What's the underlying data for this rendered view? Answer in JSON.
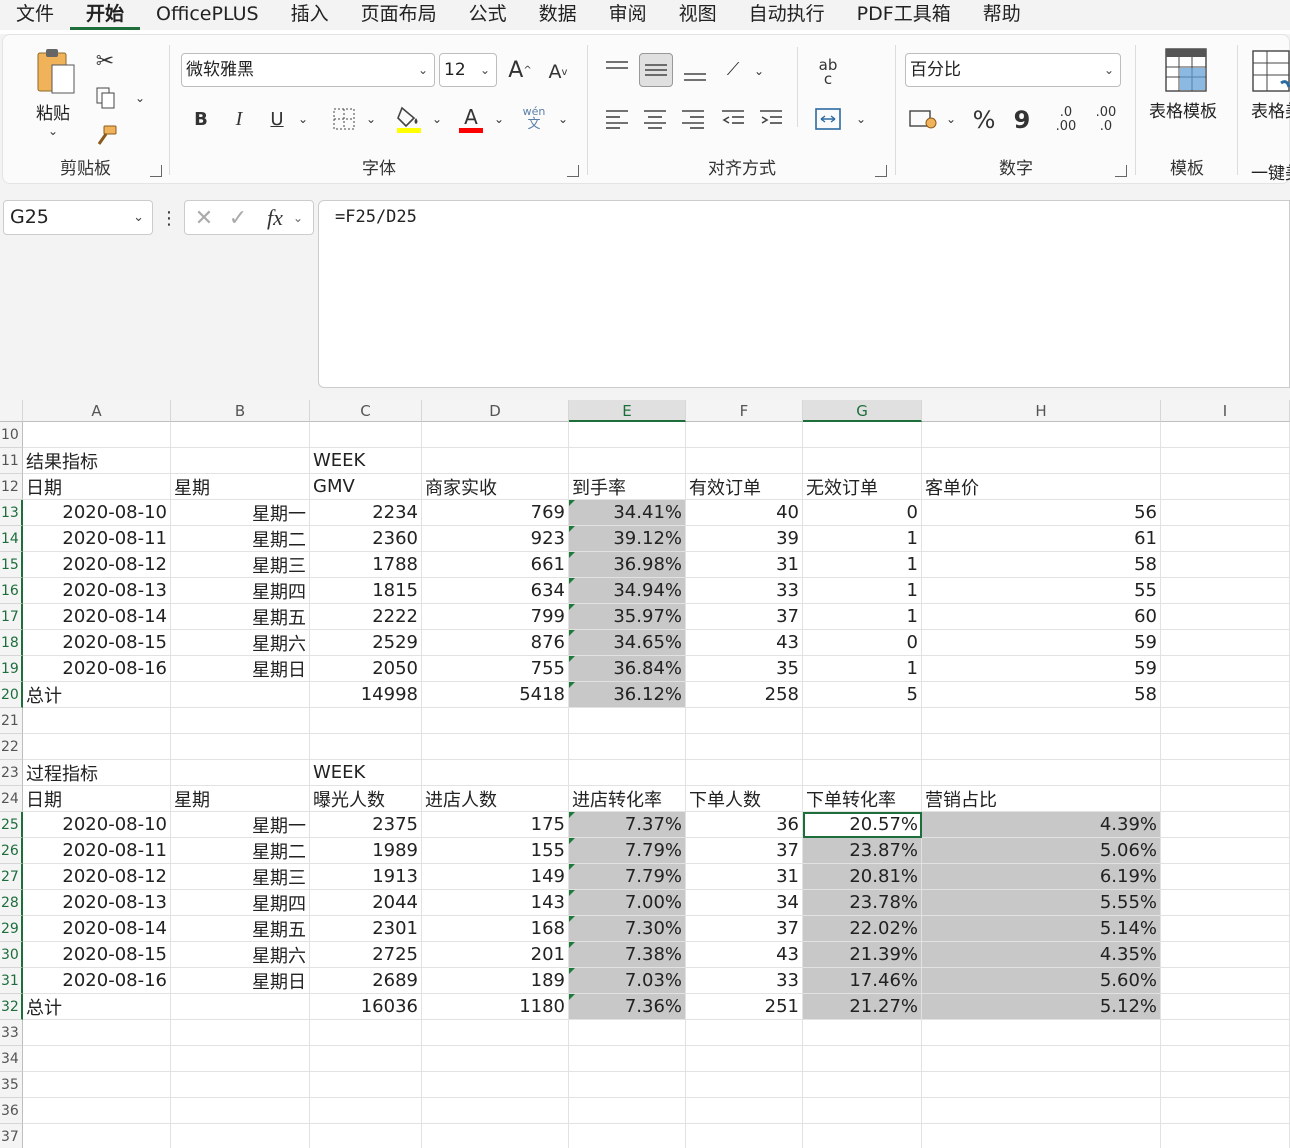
{
  "menu": [
    "文件",
    "开始",
    "OfficePLUS",
    "插入",
    "页面布局",
    "公式",
    "数据",
    "审阅",
    "视图",
    "自动执行",
    "PDF工具箱",
    "帮助"
  ],
  "ribbon": {
    "clipboard": {
      "label": "剪贴板",
      "paste": "粘贴"
    },
    "font": {
      "label": "字体",
      "font_name": "微软雅黑",
      "font_size": "12",
      "bold": "B",
      "italic": "I",
      "underline": "U",
      "grow": "A",
      "shrink": "A",
      "font_color": "A",
      "phonetic_top": "wén",
      "phonetic_bottom": "文"
    },
    "alignment": {
      "label": "对齐方式",
      "abc_top": "ab",
      "abc_bottom": "c"
    },
    "number": {
      "label": "数字",
      "format": "百分比",
      "percent": "%",
      "comma": "9",
      "inc_top": ".0",
      "inc_bottom": ".00",
      "dec_top": ".00",
      "dec_bottom": ".0"
    },
    "templates": {
      "label": "模板",
      "btn": "表格模板"
    },
    "oneclick": {
      "label": "一键美",
      "btn": "表格美"
    }
  },
  "formula_bar": {
    "name_box": "G25",
    "fx": "fx",
    "formula": "=F25/D25"
  },
  "columns": [
    "A",
    "B",
    "C",
    "D",
    "E",
    "F",
    "G",
    "H",
    "I"
  ],
  "row_numbers": [
    "10",
    "11",
    "12",
    "13",
    "14",
    "15",
    "16",
    "17",
    "18",
    "19",
    "20",
    "21",
    "22",
    "23",
    "24",
    "25",
    "26",
    "27",
    "28",
    "29",
    "30",
    "31",
    "32",
    "33",
    "34",
    "35",
    "36",
    "37"
  ],
  "table1": {
    "title": "结果指标",
    "week": "WEEK",
    "headers": [
      "日期",
      "星期",
      "GMV",
      "商家实收",
      "到手率",
      "有效订单",
      "无效订单",
      "客单价"
    ],
    "rows": [
      [
        "2020-08-10",
        "星期一",
        "2234",
        "769",
        "34.41%",
        "40",
        "0",
        "56"
      ],
      [
        "2020-08-11",
        "星期二",
        "2360",
        "923",
        "39.12%",
        "39",
        "1",
        "61"
      ],
      [
        "2020-08-12",
        "星期三",
        "1788",
        "661",
        "36.98%",
        "31",
        "1",
        "58"
      ],
      [
        "2020-08-13",
        "星期四",
        "1815",
        "634",
        "34.94%",
        "33",
        "1",
        "55"
      ],
      [
        "2020-08-14",
        "星期五",
        "2222",
        "799",
        "35.97%",
        "37",
        "1",
        "60"
      ],
      [
        "2020-08-15",
        "星期六",
        "2529",
        "876",
        "34.65%",
        "43",
        "0",
        "59"
      ],
      [
        "2020-08-16",
        "星期日",
        "2050",
        "755",
        "36.84%",
        "35",
        "1",
        "59"
      ]
    ],
    "total": [
      "总计",
      "",
      "14998",
      "5418",
      "36.12%",
      "258",
      "5",
      "58"
    ]
  },
  "table2": {
    "title": "过程指标",
    "week": "WEEK",
    "headers": [
      "日期",
      "星期",
      "曝光人数",
      "进店人数",
      "进店转化率",
      "下单人数",
      "下单转化率",
      "营销占比"
    ],
    "rows": [
      [
        "2020-08-10",
        "星期一",
        "2375",
        "175",
        "7.37%",
        "36",
        "20.57%",
        "4.39%"
      ],
      [
        "2020-08-11",
        "星期二",
        "1989",
        "155",
        "7.79%",
        "37",
        "23.87%",
        "5.06%"
      ],
      [
        "2020-08-12",
        "星期三",
        "1913",
        "149",
        "7.79%",
        "31",
        "20.81%",
        "6.19%"
      ],
      [
        "2020-08-13",
        "星期四",
        "2044",
        "143",
        "7.00%",
        "34",
        "23.78%",
        "5.55%"
      ],
      [
        "2020-08-14",
        "星期五",
        "2301",
        "168",
        "7.30%",
        "37",
        "22.02%",
        "5.14%"
      ],
      [
        "2020-08-15",
        "星期六",
        "2725",
        "201",
        "7.38%",
        "43",
        "21.39%",
        "4.35%"
      ],
      [
        "2020-08-16",
        "星期日",
        "2689",
        "189",
        "7.03%",
        "33",
        "17.46%",
        "5.60%"
      ]
    ],
    "total": [
      "总计",
      "",
      "16036",
      "1180",
      "7.36%",
      "251",
      "21.27%",
      "5.12%"
    ]
  }
}
